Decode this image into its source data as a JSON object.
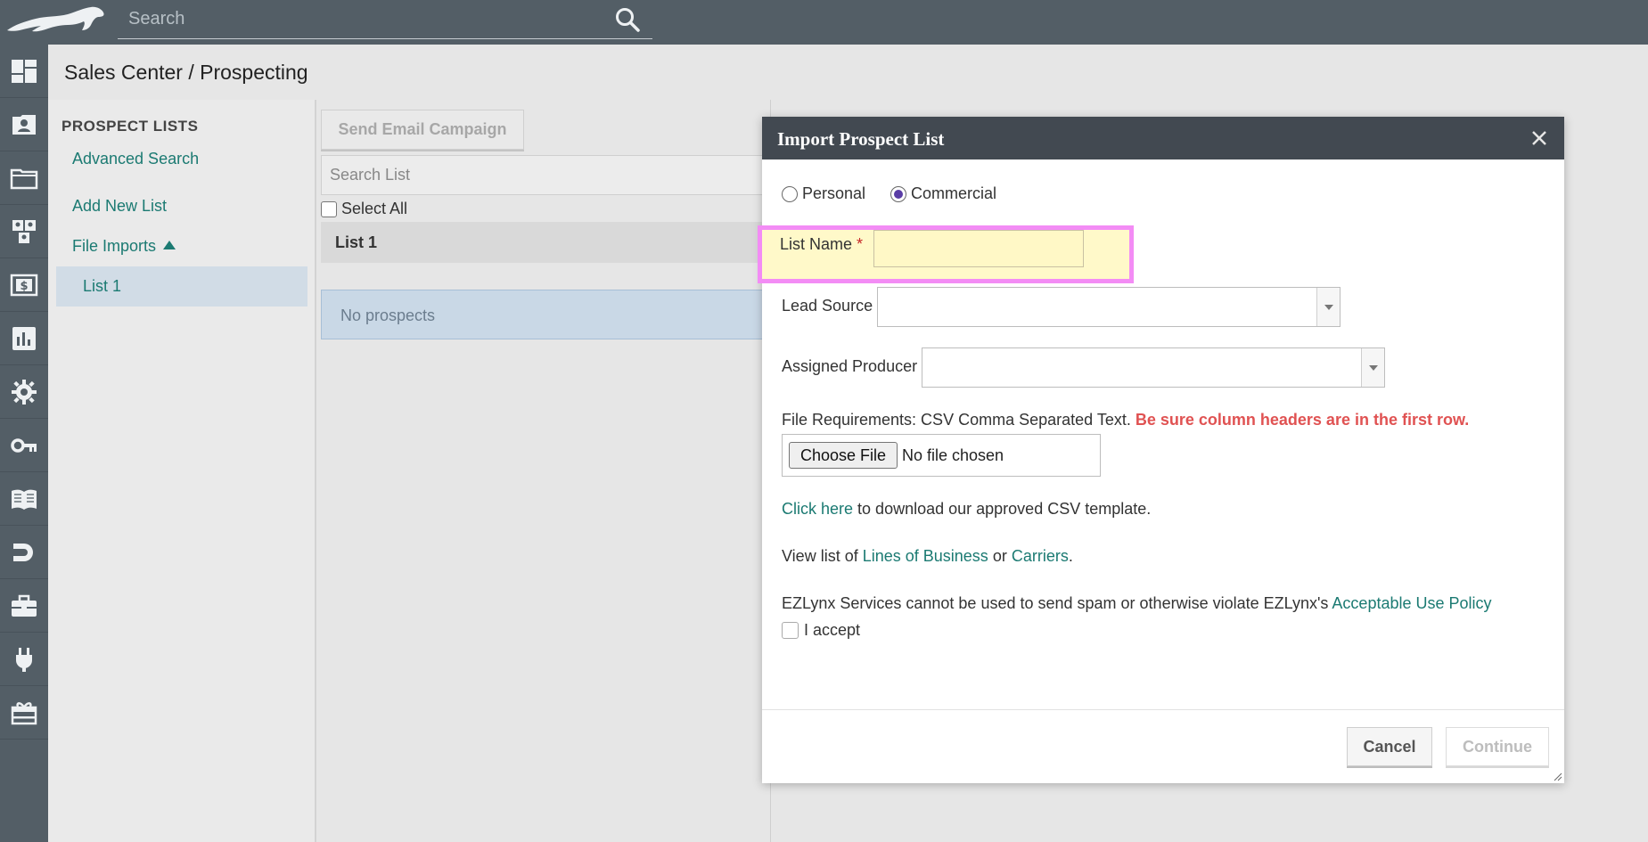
{
  "topbar": {
    "search_placeholder": "Search"
  },
  "page": {
    "title": "Sales Center / Prospecting"
  },
  "leftnav": {
    "icons": [
      "dashboard-icon",
      "contact-card-icon",
      "folder-icon",
      "team-icon",
      "dollar-icon",
      "bar-chart-icon",
      "gear-icon",
      "key-icon",
      "book-icon",
      "magnet-icon",
      "briefcase-icon",
      "plug-icon",
      "gift-icon"
    ]
  },
  "lists_panel": {
    "header": "PROSPECT LISTS",
    "advanced_search": "Advanced Search",
    "add_new_list": "Add New List",
    "file_imports": "File Imports",
    "selected_list": "List 1"
  },
  "middle": {
    "send_email_campaign": "Send Email Campaign",
    "search_list_placeholder": "Search List",
    "select_all": "Select All",
    "list_header": "List 1",
    "no_prospects": "No prospects"
  },
  "modal": {
    "title": "Import Prospect List",
    "radio_personal": "Personal",
    "radio_commercial": "Commercial",
    "selected_type": "Commercial",
    "list_name_label": "List Name",
    "required_mark": "*",
    "list_name_value": "",
    "lead_source_label": "Lead Source",
    "lead_source_value": "",
    "assigned_producer_label": "Assigned Producer",
    "assigned_producer_value": "",
    "file_req_text": "File Requirements: CSV Comma Separated Text.",
    "file_req_warning": "Be sure column headers are in the first row.",
    "choose_file": "Choose File",
    "no_file_chosen": "No file chosen",
    "click_here": "Click here",
    "download_text": "to download our approved CSV template.",
    "view_list_prefix": "View list of",
    "lines_of_business": "Lines of Business",
    "or_text": "or",
    "carriers": "Carriers",
    "period": ".",
    "policy_text": "EZLynx Services cannot be used to send spam or otherwise violate EZLynx's",
    "acceptable_use_policy": "Acceptable Use Policy",
    "i_accept": "I accept",
    "cancel": "Cancel",
    "continue": "Continue"
  },
  "colors": {
    "topbar": "#535e66",
    "link": "#1b7a72",
    "highlight_border": "#f38cf5",
    "highlight_fill": "#fff9c9",
    "warning": "#e05252"
  }
}
